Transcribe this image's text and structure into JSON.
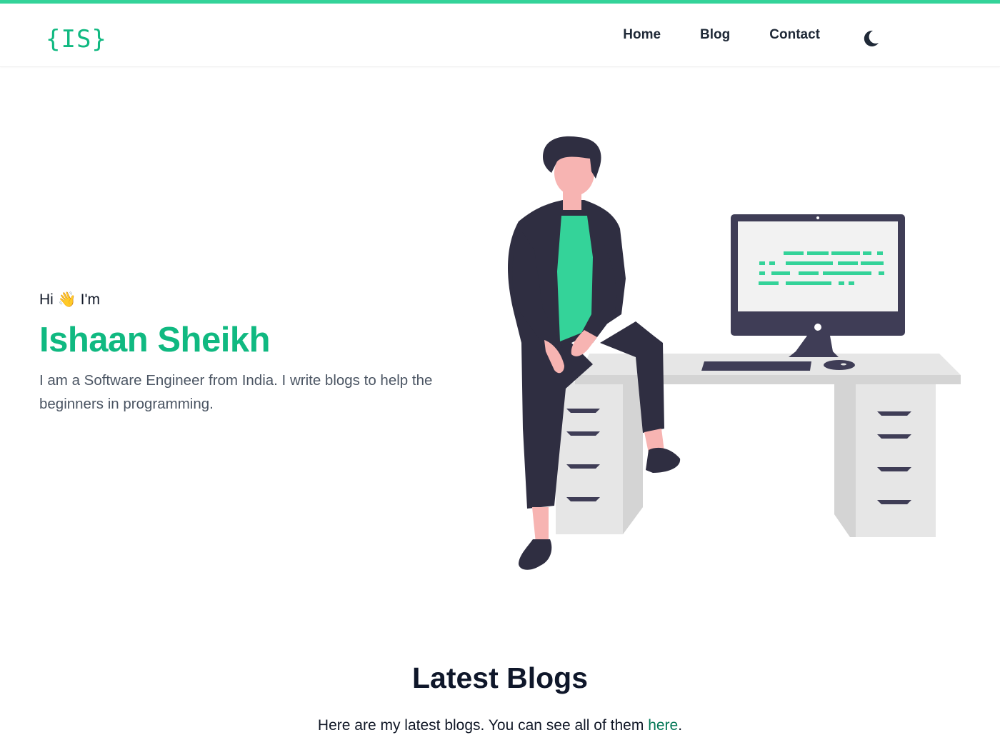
{
  "colors": {
    "accent": "#34d399",
    "brand_green": "#10b981",
    "text_dark": "#111827",
    "text_muted": "#4b5563",
    "figure_dark": "#2f2e41",
    "skin": "#f7b4b2"
  },
  "header": {
    "logo": "{IS}",
    "nav": [
      {
        "label": "Home"
      },
      {
        "label": "Blog"
      },
      {
        "label": "Contact"
      }
    ],
    "theme_toggle_icon": "moon-icon"
  },
  "hero": {
    "greeting": "Hi 👋 I'm",
    "name": "Ishaan Sheikh",
    "intro": "I am a Software Engineer from India. I write blogs to help the beginners in programming."
  },
  "blogs": {
    "title": "Latest Blogs",
    "subtitle_prefix": "Here are my latest blogs. You can see all of them ",
    "subtitle_link": "here",
    "subtitle_suffix": "."
  }
}
